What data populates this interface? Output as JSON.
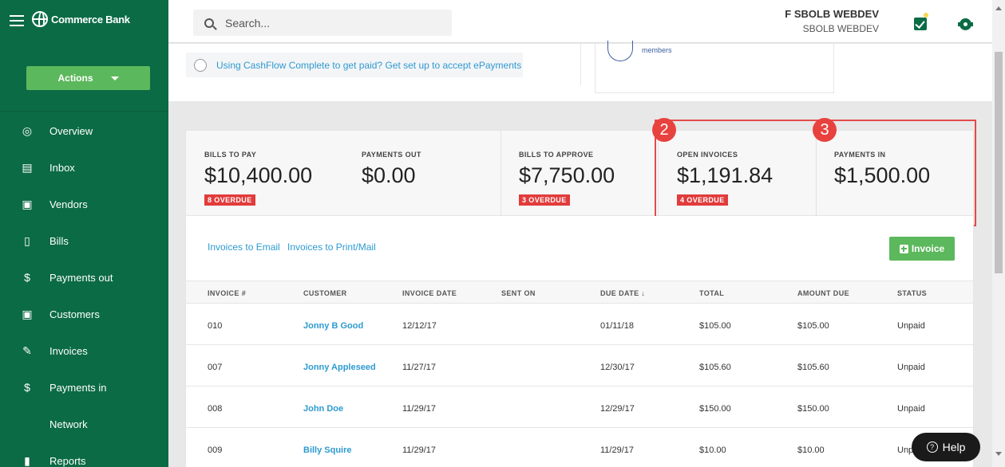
{
  "sidebar": {
    "brand": "Commerce Bank",
    "actions_label": "Actions",
    "items": [
      {
        "label": "Overview",
        "icon": "overview-icon"
      },
      {
        "label": "Inbox",
        "icon": "inbox-icon"
      },
      {
        "label": "Vendors",
        "icon": "vendors-icon"
      },
      {
        "label": "Bills",
        "icon": "bills-icon"
      },
      {
        "label": "Payments out",
        "icon": "payments-out-icon"
      },
      {
        "label": "Customers",
        "icon": "customers-icon"
      },
      {
        "label": "Invoices",
        "icon": "invoices-icon"
      },
      {
        "label": "Payments in",
        "icon": "payments-in-icon"
      },
      {
        "label": "Network",
        "icon": ""
      },
      {
        "label": "Reports",
        "icon": "reports-icon"
      }
    ]
  },
  "topbar": {
    "search_placeholder": "Search...",
    "user_name": "F SBOLB WEBDEV",
    "user_org": "SBOLB WEBDEV"
  },
  "upper": {
    "promo_text": "Using CashFlow Complete to get paid? Get set up to accept ePayments",
    "members_text": "members"
  },
  "summary": {
    "cards": [
      {
        "label": "BILLS TO PAY",
        "amount": "$10,400.00",
        "badge": "8 OVERDUE"
      },
      {
        "label": "PAYMENTS OUT",
        "amount": "$0.00",
        "badge": ""
      },
      {
        "label": "BILLS TO APPROVE",
        "amount": "$7,750.00",
        "badge": "3 OVERDUE"
      },
      {
        "label": "OPEN INVOICES",
        "amount": "$1,191.84",
        "badge": "4 OVERDUE"
      },
      {
        "label": "PAYMENTS IN",
        "amount": "$1,500.00",
        "badge": ""
      }
    ],
    "markers": [
      "2",
      "3"
    ]
  },
  "table": {
    "link_email": "Invoices to Email",
    "link_print": "Invoices to Print/Mail",
    "invoice_button": "Invoice",
    "headers": [
      "INVOICE #",
      "CUSTOMER",
      "INVOICE DATE",
      "SENT ON",
      "DUE DATE ↓",
      "TOTAL",
      "AMOUNT DUE",
      "STATUS"
    ],
    "rows": [
      [
        "010",
        "Jonny B Good",
        "12/12/17",
        "",
        "01/11/18",
        "$105.00",
        "$105.00",
        "Unpaid"
      ],
      [
        "007",
        "Jonny Appleseed",
        "11/27/17",
        "",
        "12/30/17",
        "$105.60",
        "$105.60",
        "Unpaid"
      ],
      [
        "008",
        "John Doe",
        "11/29/17",
        "",
        "12/29/17",
        "$150.00",
        "$150.00",
        "Unpaid"
      ],
      [
        "009",
        "Billy Squire",
        "11/29/17",
        "",
        "11/29/17",
        "$10.00",
        "$10.00",
        "Unpaid"
      ]
    ]
  },
  "help_label": "Help",
  "colors": {
    "sidebar_green": "#0b6b45",
    "button_green": "#5cb85c",
    "link_blue": "#2e9ad0",
    "overdue_red": "#e23b3b",
    "annotation_red": "#e34a4a"
  }
}
